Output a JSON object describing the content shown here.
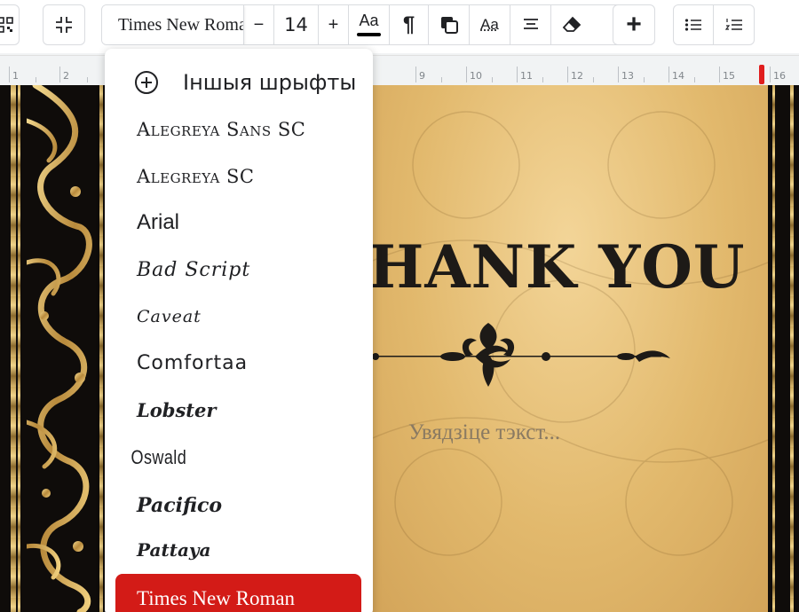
{
  "toolbar": {
    "font_name": "Times New Roman",
    "font_size": "14",
    "minus_label": "−",
    "plus_label": "+",
    "text_style_label": "Aa",
    "pilcrow_label": "¶",
    "case_label": "Aa",
    "insert_label": "+"
  },
  "ruler": {
    "numbers": [
      "1",
      "2",
      "9",
      "10",
      "11",
      "12",
      "13",
      "14",
      "15",
      "16"
    ],
    "accent_color": "#e01e1e"
  },
  "dropdown": {
    "more_fonts_label": "Іншыя шрыфты",
    "fonts": [
      "Alegreya Sans SC",
      "Alegreya SC",
      "Arial",
      "Bad Script",
      "Caveat",
      "Comfortaa",
      "Lobster",
      "Oswald",
      "Pacifico",
      "Pattaya",
      "Times New Roman"
    ],
    "selected_font": "Times New Roman",
    "selected_color": "#d31b17"
  },
  "document": {
    "heading": "HANK YOU",
    "placeholder": "Увядзіце тэкст...",
    "card_color": "#e2b96d",
    "border_gold": "#c8a55a"
  }
}
